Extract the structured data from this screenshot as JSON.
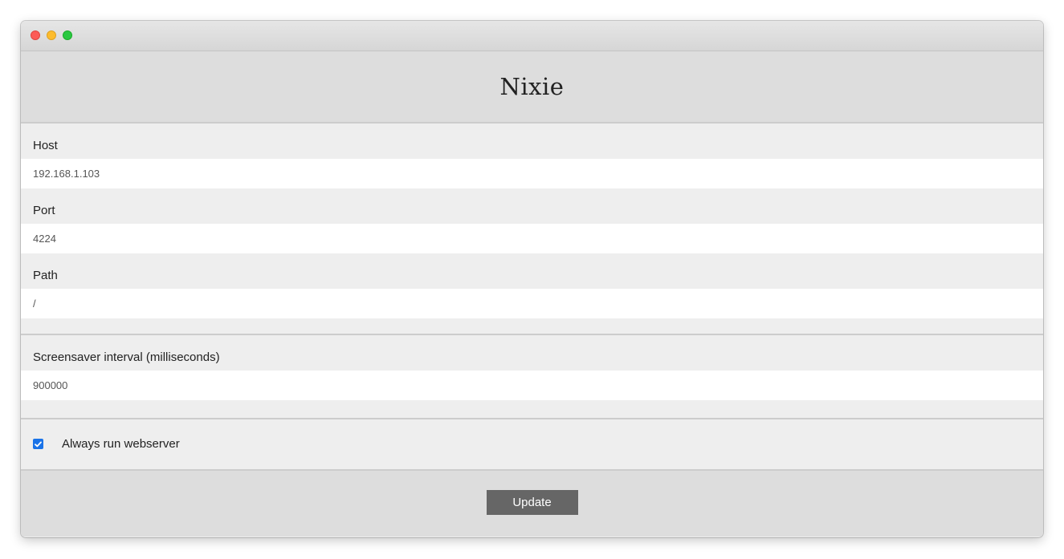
{
  "app": {
    "title": "Nixie"
  },
  "window": {
    "traffic_lights": [
      "close",
      "minimize",
      "maximize"
    ]
  },
  "connection": {
    "host": {
      "label": "Host",
      "value": "192.168.1.103"
    },
    "port": {
      "label": "Port",
      "value": "4224"
    },
    "path": {
      "label": "Path",
      "value": "/"
    }
  },
  "screensaver": {
    "label": "Screensaver interval (milliseconds)",
    "value": "900000"
  },
  "webserver": {
    "label": "Always run webserver",
    "checked": true
  },
  "actions": {
    "update_label": "Update"
  },
  "colors": {
    "accent": "#1a73e8",
    "button": "#666666",
    "header_bg": "#dddddd",
    "section_bg": "#eeeeee"
  }
}
